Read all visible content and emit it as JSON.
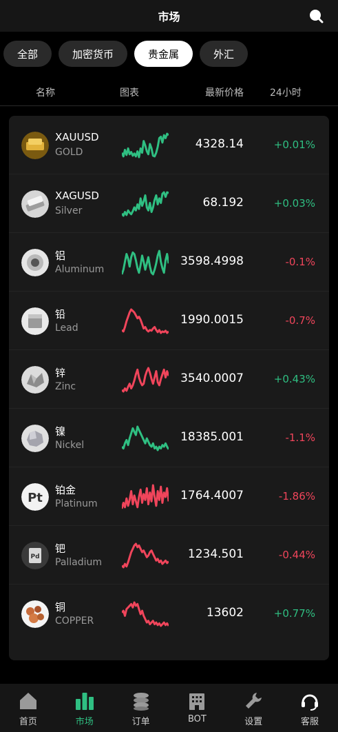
{
  "header": {
    "title": "市场"
  },
  "tabs": [
    {
      "label": "全部",
      "active": false
    },
    {
      "label": "加密货币",
      "active": false
    },
    {
      "label": "贵金属",
      "active": true
    },
    {
      "label": "外汇",
      "active": false
    }
  ],
  "columns": {
    "name": "名称",
    "chart": "图表",
    "price": "最新价格",
    "change": "24小时"
  },
  "colors": {
    "up": "#2fbf82",
    "down": "#f0455b",
    "accent": "#2fbf82"
  },
  "rows": [
    {
      "name": "XAUUSD",
      "sub": "GOLD",
      "price": "4328.14",
      "change": "+0.01%",
      "dir": "up",
      "icon": "gold-bar-icon",
      "spark": [
        8,
        3,
        12,
        5,
        14,
        6,
        9,
        4,
        7,
        3,
        10,
        2,
        14,
        8,
        24,
        18,
        10,
        6,
        20,
        14,
        4,
        3,
        8,
        16,
        28,
        30,
        22,
        32,
        28,
        34,
        32
      ]
    },
    {
      "name": "XAGUSD",
      "sub": "Silver",
      "price": "68.192",
      "change": "+0.03%",
      "dir": "up",
      "icon": "silver-bar-icon",
      "spark": [
        6,
        3,
        8,
        4,
        10,
        7,
        5,
        9,
        14,
        10,
        18,
        12,
        26,
        16,
        22,
        30,
        14,
        10,
        20,
        8,
        14,
        24,
        30,
        18,
        26,
        20,
        32,
        34,
        28,
        34,
        33
      ]
    },
    {
      "name": "铝",
      "sub": "Aluminum",
      "price": "3598.4998",
      "change": "-0.1%",
      "dir": "up",
      "icon": "aluminum-coil-icon",
      "spark": [
        4,
        10,
        20,
        30,
        24,
        14,
        26,
        32,
        30,
        22,
        12,
        6,
        16,
        28,
        20,
        10,
        18,
        26,
        14,
        6,
        4,
        10,
        18,
        28,
        34,
        20,
        12,
        6,
        22,
        30,
        18
      ]
    },
    {
      "name": "铅",
      "sub": "Lead",
      "price": "1990.0015",
      "change": "-0.7%",
      "dir": "down",
      "icon": "lead-block-icon",
      "spark": [
        6,
        4,
        10,
        18,
        24,
        30,
        34,
        32,
        30,
        26,
        22,
        24,
        20,
        14,
        8,
        10,
        6,
        4,
        6,
        5,
        8,
        10,
        6,
        3,
        6,
        2,
        4,
        3,
        5,
        2,
        4
      ]
    },
    {
      "name": "锌",
      "sub": "Zinc",
      "price": "3540.0007",
      "change": "+0.43%",
      "dir": "down",
      "icon": "zinc-icon",
      "spark": [
        4,
        2,
        6,
        3,
        8,
        12,
        6,
        10,
        16,
        24,
        30,
        20,
        14,
        10,
        12,
        22,
        28,
        32,
        26,
        18,
        12,
        20,
        28,
        14,
        10,
        18,
        24,
        30,
        20,
        28,
        22
      ]
    },
    {
      "name": "镍",
      "sub": "Nickel",
      "price": "18385.001",
      "change": "-1.1%",
      "dir": "up",
      "icon": "nickel-icon",
      "spark": [
        6,
        4,
        10,
        14,
        8,
        16,
        22,
        28,
        24,
        20,
        30,
        26,
        22,
        18,
        14,
        10,
        16,
        12,
        8,
        6,
        10,
        4,
        6,
        2,
        6,
        4,
        8,
        6,
        10,
        6,
        3
      ]
    },
    {
      "name": "铂金",
      "sub": "Platinum",
      "price": "1764.4007",
      "change": "-1.86%",
      "dir": "down",
      "icon": "platinum-pt-icon",
      "spark": [
        2,
        10,
        4,
        16,
        6,
        14,
        26,
        8,
        20,
        12,
        4,
        18,
        28,
        10,
        22,
        14,
        30,
        8,
        24,
        12,
        34,
        18,
        6,
        26,
        14,
        32,
        10,
        24,
        18,
        30,
        12
      ]
    },
    {
      "name": "钯",
      "sub": "Palladium",
      "price": "1234.501",
      "change": "-0.44%",
      "dir": "down",
      "icon": "palladium-pd-icon",
      "spark": [
        4,
        2,
        6,
        3,
        8,
        14,
        20,
        24,
        28,
        30,
        26,
        28,
        24,
        20,
        22,
        18,
        14,
        16,
        20,
        22,
        18,
        14,
        10,
        12,
        8,
        10,
        6,
        8,
        10,
        7,
        9
      ]
    },
    {
      "name": "铜",
      "sub": "COPPER",
      "price": "13602",
      "change": "+0.77%",
      "dir": "down",
      "icon": "copper-nugget-icon",
      "spark": [
        18,
        20,
        14,
        22,
        24,
        26,
        28,
        24,
        30,
        26,
        28,
        22,
        16,
        20,
        14,
        10,
        6,
        8,
        4,
        6,
        8,
        4,
        6,
        3,
        5,
        2,
        4,
        6,
        3,
        5,
        2
      ]
    }
  ],
  "nav": [
    {
      "label": "首页",
      "icon": "home-icon",
      "active": false
    },
    {
      "label": "市场",
      "icon": "market-bars-icon",
      "active": true
    },
    {
      "label": "订单",
      "icon": "coins-stack-icon",
      "active": false
    },
    {
      "label": "BOT",
      "icon": "building-bot-icon",
      "active": false
    },
    {
      "label": "设置",
      "icon": "wrench-icon",
      "active": false
    },
    {
      "label": "客服",
      "icon": "headset-icon",
      "active": false
    }
  ]
}
